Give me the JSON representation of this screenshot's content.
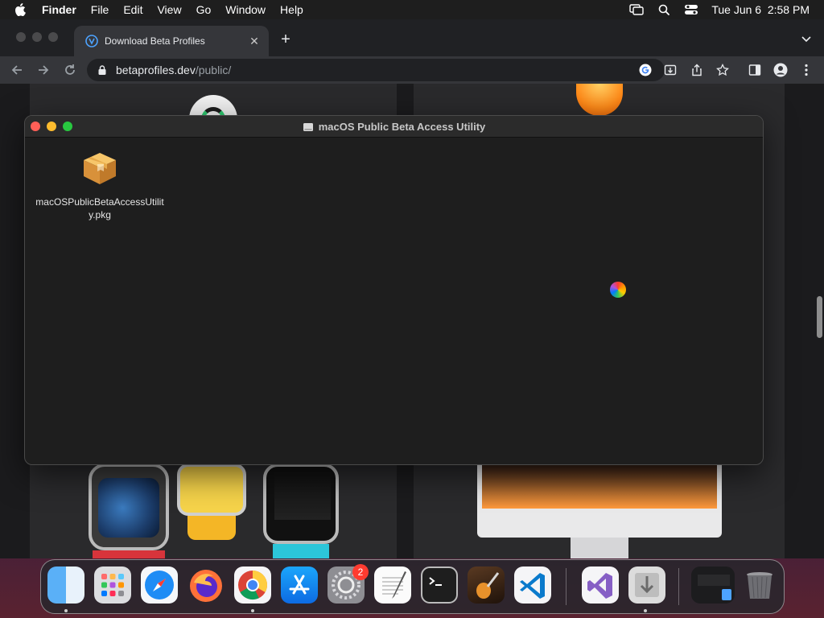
{
  "menubar": {
    "items": [
      "Finder",
      "File",
      "Edit",
      "View",
      "Go",
      "Window",
      "Help"
    ],
    "clock": "Tue Jun 6  2:58 PM"
  },
  "browser": {
    "tab_title": "Download Beta Profiles",
    "new_tab_label": "+",
    "url_host": "betaprofiles.dev",
    "url_path": "/public/"
  },
  "finder_window": {
    "title": "macOS Public Beta Access Utility",
    "file_name": "macOSPublicBetaAccessUtility.pkg"
  },
  "dock": {
    "apps": [
      "Finder",
      "Launchpad",
      "Safari",
      "Firefox",
      "Google Chrome",
      "App Store",
      "System Settings",
      "TextEdit",
      "Terminal",
      "GarageBand",
      "Visual Studio Code",
      "Visual Studio",
      "Installer",
      "Downloads",
      "Trash"
    ],
    "settings_badge": "2"
  },
  "colors": {
    "close": "#ff5f57",
    "minimize": "#febc2e",
    "zoom": "#28c840"
  }
}
